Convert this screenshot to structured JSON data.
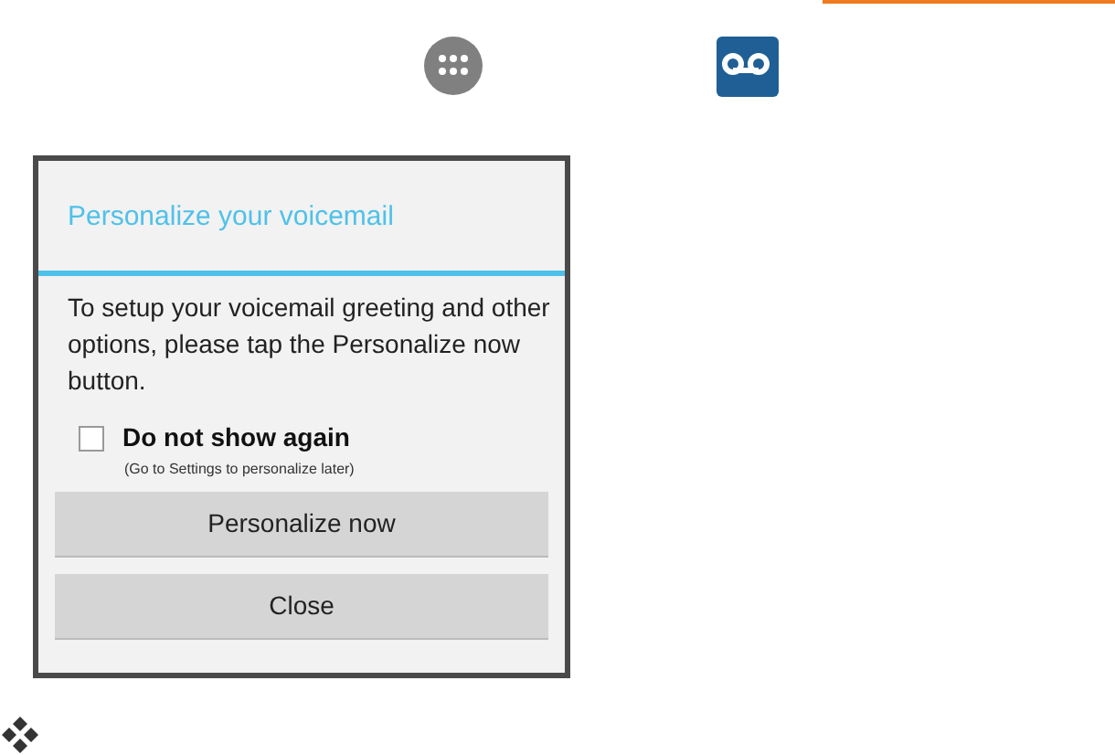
{
  "dialog": {
    "title": "Personalize your voicemail",
    "message": "To setup your voicemail greeting and other options, please tap the Personalize now button.",
    "checkbox": {
      "label": "Do not show again",
      "hint": "(Go to Settings to personalize later)",
      "checked": false
    },
    "buttons": [
      "Personalize now",
      "Close"
    ]
  }
}
